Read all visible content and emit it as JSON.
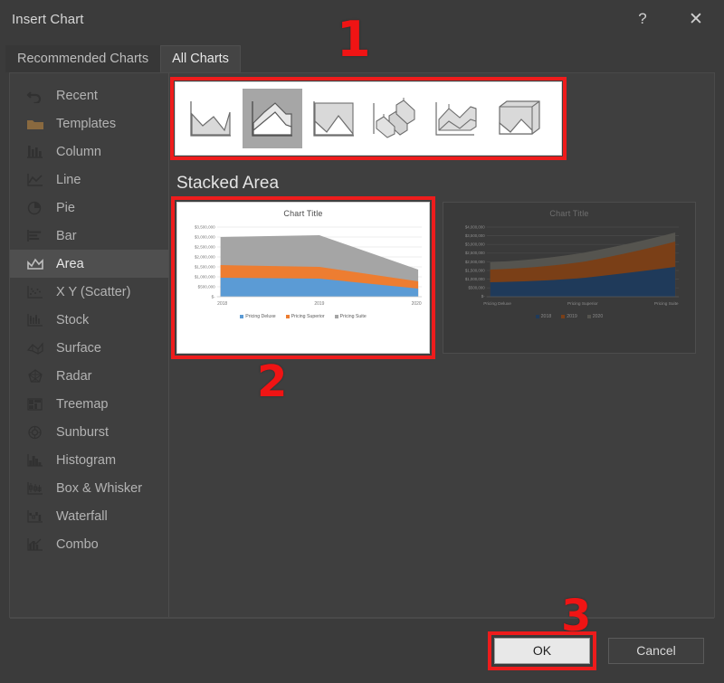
{
  "window": {
    "title": "Insert Chart",
    "help_icon": "help-icon",
    "help_label": "?",
    "close_icon": "close-icon",
    "close_label": "✕"
  },
  "tabs": [
    {
      "label": "Recommended Charts",
      "active": false
    },
    {
      "label": "All Charts",
      "active": true
    }
  ],
  "sidebar": {
    "items": [
      {
        "label": "Recent",
        "icon": "recent-icon",
        "selected": false
      },
      {
        "label": "Templates",
        "icon": "templates-icon",
        "selected": false
      },
      {
        "label": "Column",
        "icon": "column-icon",
        "selected": false
      },
      {
        "label": "Line",
        "icon": "line-icon",
        "selected": false
      },
      {
        "label": "Pie",
        "icon": "pie-icon",
        "selected": false
      },
      {
        "label": "Bar",
        "icon": "bar-icon",
        "selected": false
      },
      {
        "label": "Area",
        "icon": "area-icon",
        "selected": true
      },
      {
        "label": "X Y (Scatter)",
        "icon": "scatter-icon",
        "selected": false
      },
      {
        "label": "Stock",
        "icon": "stock-icon",
        "selected": false
      },
      {
        "label": "Surface",
        "icon": "surface-icon",
        "selected": false
      },
      {
        "label": "Radar",
        "icon": "radar-icon",
        "selected": false
      },
      {
        "label": "Treemap",
        "icon": "treemap-icon",
        "selected": false
      },
      {
        "label": "Sunburst",
        "icon": "sunburst-icon",
        "selected": false
      },
      {
        "label": "Histogram",
        "icon": "histogram-icon",
        "selected": false
      },
      {
        "label": "Box & Whisker",
        "icon": "box-whisker-icon",
        "selected": false
      },
      {
        "label": "Waterfall",
        "icon": "waterfall-icon",
        "selected": false
      },
      {
        "label": "Combo",
        "icon": "combo-icon",
        "selected": false
      }
    ]
  },
  "gallery": {
    "subtypes": [
      {
        "name": "area",
        "selected": false
      },
      {
        "name": "stacked-area",
        "selected": true
      },
      {
        "name": "100-percent-stacked-area",
        "selected": false
      },
      {
        "name": "3d-area",
        "selected": false
      },
      {
        "name": "3d-stacked-area",
        "selected": false
      },
      {
        "name": "3d-100-percent-stacked-area",
        "selected": false
      }
    ]
  },
  "section": {
    "title": "Stacked Area"
  },
  "annotations": {
    "one": "1",
    "two": "2",
    "three": "3"
  },
  "footer": {
    "ok_label": "OK",
    "cancel_label": "Cancel"
  },
  "colors": {
    "series1": "#5B9BD5",
    "series2": "#ED7D31",
    "series3": "#A5A5A5",
    "series1_dim": "#1F3A5A",
    "series2_dim": "#7A3F17",
    "series3_dim": "#55544F",
    "annotation_red": "#F01414",
    "dialog_bg": "#3B3B3B"
  },
  "chart_data": [
    {
      "type": "area",
      "subtype": "stacked-area",
      "title": "Chart Title",
      "xlabel": "",
      "ylabel": "",
      "categories": [
        "2018",
        "2019",
        "2020"
      ],
      "series": [
        {
          "name": "Pricing Deluxe",
          "values": [
            1000000,
            1000000,
            700000
          ],
          "color": "#5B9BD5"
        },
        {
          "name": "Pricing Superior",
          "values": [
            800000,
            800000,
            600000
          ],
          "color": "#ED7D31"
        },
        {
          "name": "Pricing Suite",
          "values": [
            1200000,
            1350000,
            800000
          ],
          "color": "#A5A5A5"
        }
      ],
      "ytick_labels": [
        "$3,500,000",
        "$3,000,000",
        "$2,500,000",
        "$2,000,000",
        "$1,500,000",
        "$1,000,000",
        "$500,000",
        "$-"
      ],
      "ylim": [
        0,
        3500000
      ],
      "grid": true,
      "legend_position": "bottom"
    },
    {
      "type": "area",
      "subtype": "stacked-area-by-series",
      "title": "Chart Title",
      "xlabel": "",
      "ylabel": "",
      "categories": [
        "Pricing Deluxe",
        "Pricing Superior",
        "Pricing Suite"
      ],
      "series": [
        {
          "name": "2018",
          "values": [
            1000000,
            1100000,
            1500000
          ],
          "color": "#1F3A5A"
        },
        {
          "name": "2019",
          "values": [
            700000,
            800000,
            1100000
          ],
          "color": "#7A3F17"
        },
        {
          "name": "2020",
          "values": [
            500000,
            600000,
            800000
          ],
          "color": "#55544F"
        }
      ],
      "ytick_labels": [
        "$4,000,000",
        "$3,500,000",
        "$3,000,000",
        "$2,500,000",
        "$2,000,000",
        "$1,500,000",
        "$1,000,000",
        "$500,000",
        "$-"
      ],
      "ylim": [
        0,
        4000000
      ],
      "grid": true,
      "legend_position": "bottom"
    }
  ]
}
